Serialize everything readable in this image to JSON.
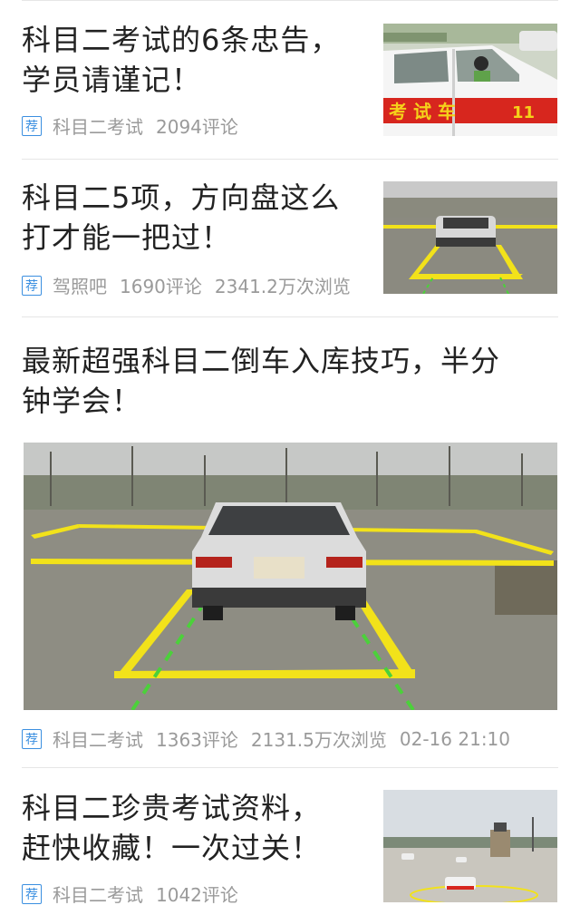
{
  "articles": [
    {
      "title": "科目二考试的6条忠告，\n学员请谨记！",
      "tag": "荐",
      "source": "科目二考试",
      "comments": "2094评论",
      "thumb_label": "考 试 车",
      "thumb_number": "11"
    },
    {
      "title": "科目二5项，方向盘这么\n打才能一把过！",
      "tag": "荐",
      "source": "驾照吧",
      "comments": "1690评论",
      "views": "2341.2万次浏览"
    },
    {
      "title": "最新超强科目二倒车入库技巧，半分\n钟学会！",
      "tag": "荐",
      "source": "科目二考试",
      "comments": "1363评论",
      "views": "2131.5万次浏览",
      "time": "02-16 21:10"
    },
    {
      "title": "科目二珍贵考试资料，\n赶快收藏！一次过关！",
      "tag": "荐",
      "source": "科目二考试",
      "comments": "1042评论"
    }
  ],
  "colors": {
    "tag_blue": "#3b8fe0",
    "meta_gray": "#9a9a9a",
    "title": "#222222",
    "lane_yellow": "#f2e21a",
    "lane_green": "#4bd13a",
    "exam_car_red": "#d7261e"
  }
}
